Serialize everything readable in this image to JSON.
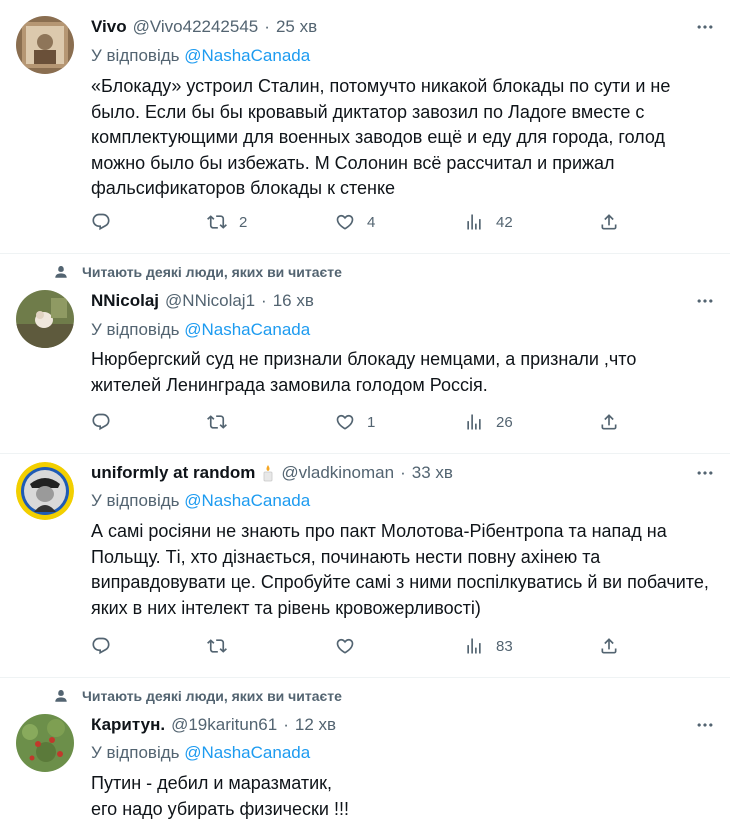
{
  "tweets": [
    {
      "name": "Vivo",
      "handle": "@Vivo42242545",
      "dot": "·",
      "time": "25 хв",
      "reply_prefix": "У відповідь",
      "reply_to": "@NashaCanada",
      "text": "«Блокаду» устроил Сталин, потомучто никакой блокады по сути и не было. Если бы бы кровавый диктатор завозил по Ладоге вместе с комплектующими для военных заводов ещё и еду для города, голод можно было бы избежать. М Солонин всё рассчитал и прижал фальсификаторов блокады к стенке",
      "retweets": "2",
      "likes": "4",
      "views": "42"
    },
    {
      "social_context": "Читають деякі люди, яких ви читаєте",
      "name": "NNicolaj",
      "handle": "@NNicolaj1",
      "dot": "·",
      "time": "16 хв",
      "reply_prefix": "У відповідь",
      "reply_to": "@NashaCanada",
      "text": "Нюрбергский суд не признали блокаду немцами, а признали ,что жителей Ленинграда замовила голодом Россія.",
      "retweets": "",
      "likes": "1",
      "views": "26"
    },
    {
      "name": "uniformly at random",
      "handle": "@vladkinoman",
      "dot": "·",
      "time": "33 хв",
      "reply_prefix": "У відповідь",
      "reply_to": "@NashaCanada",
      "text": "А самі росіяни не знають про пакт Молотова-Рібентропа та напад на Польщу. Ті, хто дізнається, починають нести повну ахінею та виправдовувати це. Спробуйте самі з ними поспілкуватись й ви побачите, яких в них інтелект та рівень кровожерливості)",
      "retweets": "",
      "likes": "",
      "views": "83"
    },
    {
      "social_context": "Читають деякі люди, яких ви читаєте",
      "name": "Каритун.",
      "handle": "@19karitun61",
      "dot": "·",
      "time": "12 хв",
      "reply_prefix": "У відповідь",
      "reply_to": "@NashaCanada",
      "text": "Путин - дебил и маразматик,\nего надо убирать физически !!!"
    }
  ],
  "icons": {
    "reply": "reply-icon",
    "retweet": "retweet-icon",
    "like": "like-icon",
    "views": "views-icon",
    "share": "share-icon",
    "more": "more-icon",
    "person": "person-icon",
    "candle": "candle-icon"
  },
  "colors": {
    "mention": "#1d9bf0",
    "secondary_text": "#536471",
    "primary_text": "#0f1419",
    "divider": "#eff3f4"
  }
}
